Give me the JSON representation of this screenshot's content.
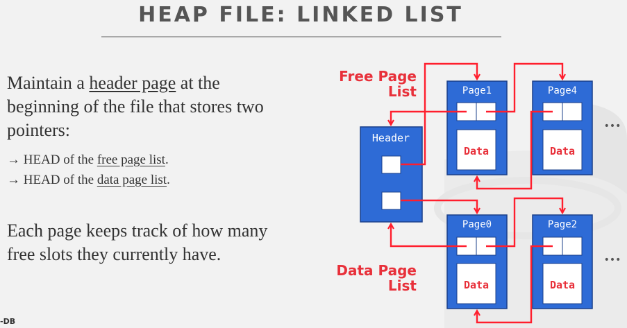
{
  "slide": {
    "title": "HEAP FILE: LINKED LIST",
    "body_line1_pre": "Maintain a ",
    "body_line1_link": "header page",
    "body_line1_post": " at the",
    "body_line2": "beginning of the file that stores two",
    "body_line3": "pointers:",
    "bullet1_pre": "→ HEAD of the ",
    "bullet1_link": "free page list",
    "bullet1_post": ".",
    "bullet2_pre": "→ HEAD of the ",
    "bullet2_link": "data page list",
    "bullet2_post": ".",
    "note_line1": "Each page keeps track of how many",
    "note_line2": "free slots they currently have.",
    "watermark": "-DB"
  },
  "diagram": {
    "free_list_label_1": "Free Page",
    "free_list_label_2": "List",
    "data_list_label_1": "Data Page",
    "data_list_label_2": "List",
    "header_label": "Header",
    "pages": {
      "page1": {
        "label": "Page1",
        "data": "Data"
      },
      "page4": {
        "label": "Page4",
        "data": "Data"
      },
      "page0": {
        "label": "Page0",
        "data": "Data"
      },
      "page2": {
        "label": "Page2",
        "data": "Data"
      }
    },
    "ellipsis": "•••",
    "colors": {
      "page_blue": "#2e6bd6",
      "arrow_red": "#ff1e2d",
      "label_red": "#e8303a"
    }
  }
}
